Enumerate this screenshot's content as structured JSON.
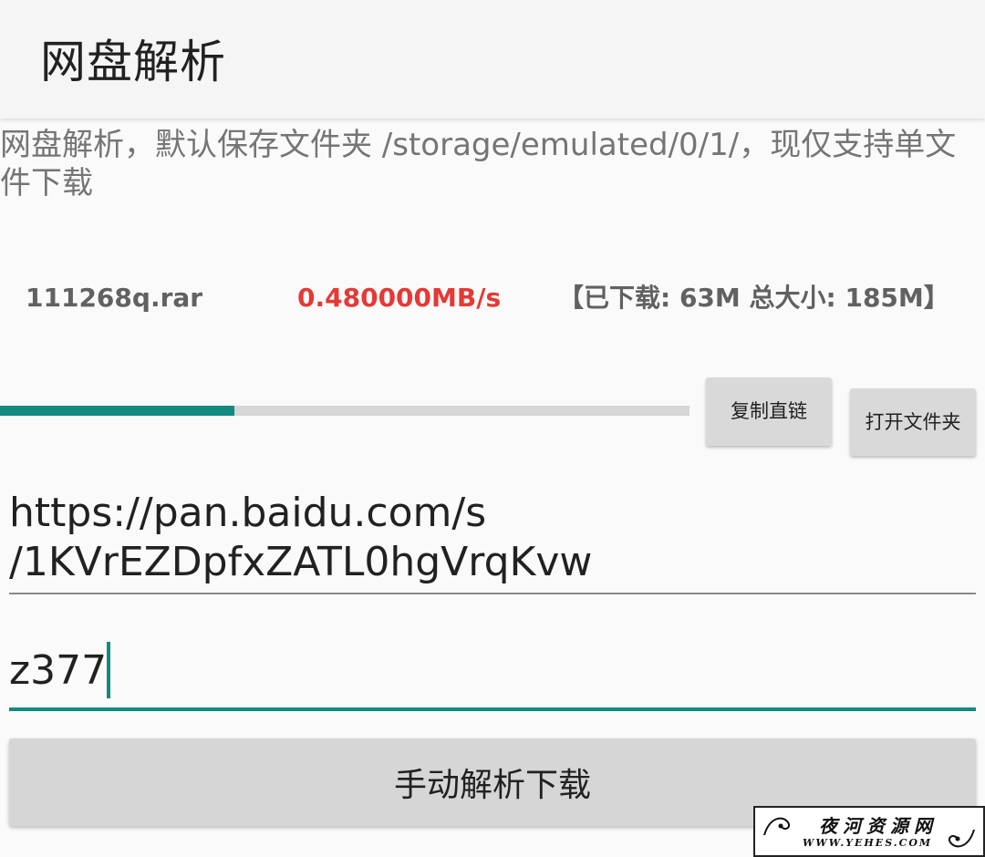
{
  "appbar": {
    "title": "网盘解析"
  },
  "description": "网盘解析，默认保存文件夹 /storage/emulated/0/1/，现仅支持单文件下载",
  "download": {
    "file_name": "111268q.rar",
    "speed": "0.480000MB/s",
    "size_info": "【已下载: 63M  总大小: 185M】",
    "progress_fraction": 0.34
  },
  "buttons": {
    "copy_link": "复制直链",
    "open_folder": "打开文件夹",
    "parse_download": "手动解析下载"
  },
  "inputs": {
    "url_value": "https://pan.baidu.com/s/1KVrEZDpfxZATL0hgVrqKvw",
    "code_value": "z377"
  },
  "watermark": {
    "title": "夜河资源网",
    "url": "WWW.YEHES.COM"
  },
  "colors": {
    "accent": "#138a80",
    "speed": "#e53935"
  }
}
